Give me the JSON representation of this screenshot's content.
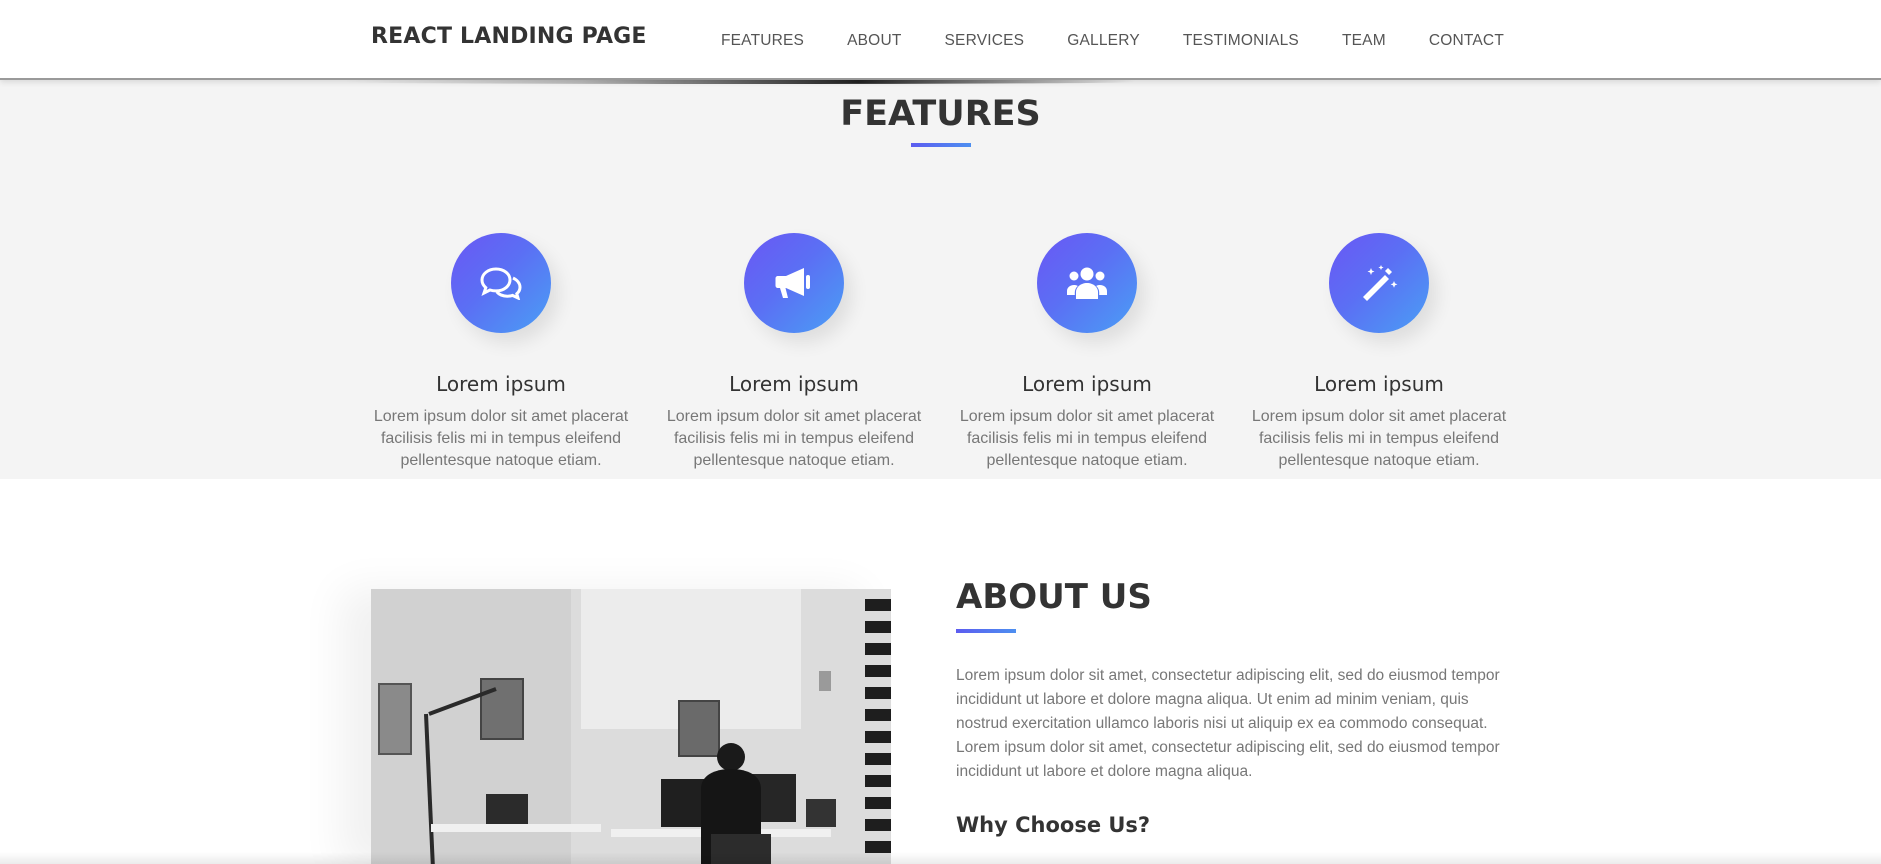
{
  "navbar": {
    "brand": "REACT LANDING PAGE",
    "links": [
      "FEATURES",
      "ABOUT",
      "SERVICES",
      "GALLERY",
      "TESTIMONIALS",
      "TEAM",
      "CONTACT"
    ]
  },
  "features": {
    "title": "FEATURES",
    "items": [
      {
        "icon": "comments-icon",
        "title": "Lorem ipsum",
        "text": "Lorem ipsum dolor sit amet placerat facilisis felis mi in tempus eleifend pellentesque natoque etiam."
      },
      {
        "icon": "bullhorn-icon",
        "title": "Lorem ipsum",
        "text": "Lorem ipsum dolor sit amet placerat facilisis felis mi in tempus eleifend pellentesque natoque etiam."
      },
      {
        "icon": "group-icon",
        "title": "Lorem ipsum",
        "text": "Lorem ipsum dolor sit amet placerat facilisis felis mi in tempus eleifend pellentesque natoque etiam."
      },
      {
        "icon": "magic-wand-icon",
        "title": "Lorem ipsum",
        "text": "Lorem ipsum dolor sit amet placerat facilisis felis mi in tempus eleifend pellentesque natoque etiam."
      }
    ]
  },
  "about": {
    "title": "ABOUT US",
    "text": "Lorem ipsum dolor sit amet, consectetur adipiscing elit, sed do eiusmod tempor incididunt ut labore et dolore magna aliqua. Ut enim ad minim veniam, quis nostrud exercitation ullamco laboris nisi ut aliquip ex ea commodo consequat. Lorem ipsum dolor sit amet, consectetur adipiscing elit, sed do eiusmod tempor incididunt ut labore et dolore magna aliqua.",
    "subtitle": "Why Choose Us?"
  },
  "colors": {
    "accent_start": "#6a57f5",
    "accent_end": "#4a9ff5",
    "features_bg": "#f4f4f4"
  }
}
